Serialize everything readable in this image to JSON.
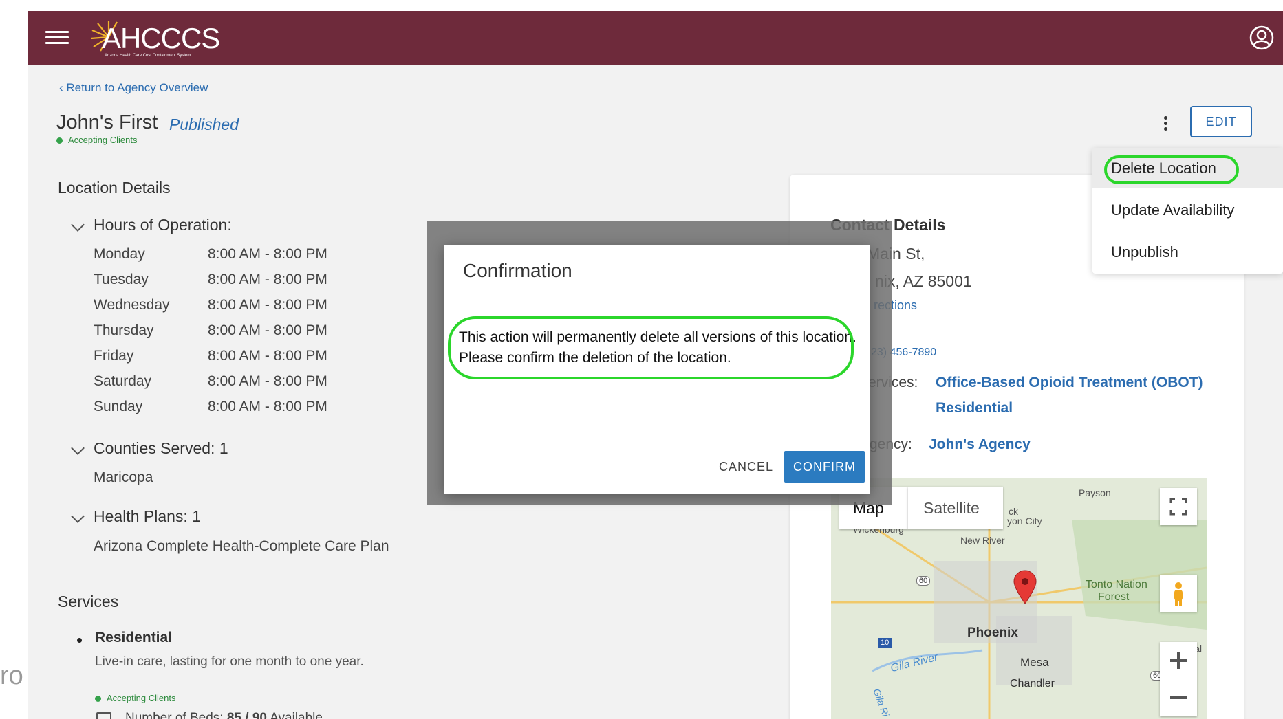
{
  "header": {
    "logo_text": "AHCCCS",
    "logo_sub": "Arizona Health Care Cost Containment System",
    "brand_color": "#6e2a3b",
    "user_icon": "account-circle-icon",
    "menu_icon": "hamburger-icon"
  },
  "breadcrumb": "Return to Agency Overview",
  "location": {
    "name": "John's First",
    "status": "Published",
    "accepting": "Accepting Clients"
  },
  "actions": {
    "edit_label": "EDIT",
    "menu": [
      "Delete Location",
      "Update Availability",
      "Unpublish"
    ]
  },
  "details": {
    "title": "Location Details",
    "hours_label": "Hours of Operation:",
    "hours": [
      {
        "day": "Monday",
        "time": "8:00 AM - 8:00 PM"
      },
      {
        "day": "Tuesday",
        "time": "8:00 AM - 8:00 PM"
      },
      {
        "day": "Wednesday",
        "time": "8:00 AM - 8:00 PM"
      },
      {
        "day": "Thursday",
        "time": "8:00 AM - 8:00 PM"
      },
      {
        "day": "Friday",
        "time": "8:00 AM - 8:00 PM"
      },
      {
        "day": "Saturday",
        "time": "8:00 AM - 8:00 PM"
      },
      {
        "day": "Sunday",
        "time": "8:00 AM - 8:00 PM"
      }
    ],
    "counties_label": "Counties Served:",
    "counties_count": "1",
    "county": "Maricopa",
    "plans_label": "Health Plans:",
    "plans_count": "1",
    "plan": "Arizona Complete Health-Complete Care Plan"
  },
  "services": {
    "title": "Services",
    "item_name": "Residential",
    "item_desc": "Live-in care, lasting for one month to one year.",
    "item_accepting": "Accepting Clients",
    "beds_label": "Number of Beds:",
    "beds_value": "85 / 90",
    "beds_suffix": "Available"
  },
  "contact": {
    "title": "Contact Details",
    "address1": "Main St,",
    "address2": "nix, AZ 85001",
    "directions": "rections",
    "phone": "23) 456-7890",
    "services_label": "ervices:",
    "services_1": "Office-Based Opioid Treatment (OBOT)",
    "services_2": "Residential",
    "agency_label": "gency:",
    "agency": "John's Agency"
  },
  "map": {
    "tab_map": "Map",
    "tab_satellite": "Satellite",
    "places": [
      "Payson",
      "ck",
      "yon City",
      "Wickenburg",
      "New River",
      "Tonto Nation",
      "Forest",
      "Phoenix",
      "Mesa",
      "Chandler",
      "Gila River",
      "Gila Ri",
      "ial"
    ],
    "routes": [
      "60",
      "10",
      "60"
    ]
  },
  "dialog": {
    "title": "Confirmation",
    "message": "This action will permanently delete all versions of this location. Please confirm the deletion of the location.",
    "cancel": "CANCEL",
    "confirm": "CONFIRM"
  },
  "edge_text": "ro"
}
